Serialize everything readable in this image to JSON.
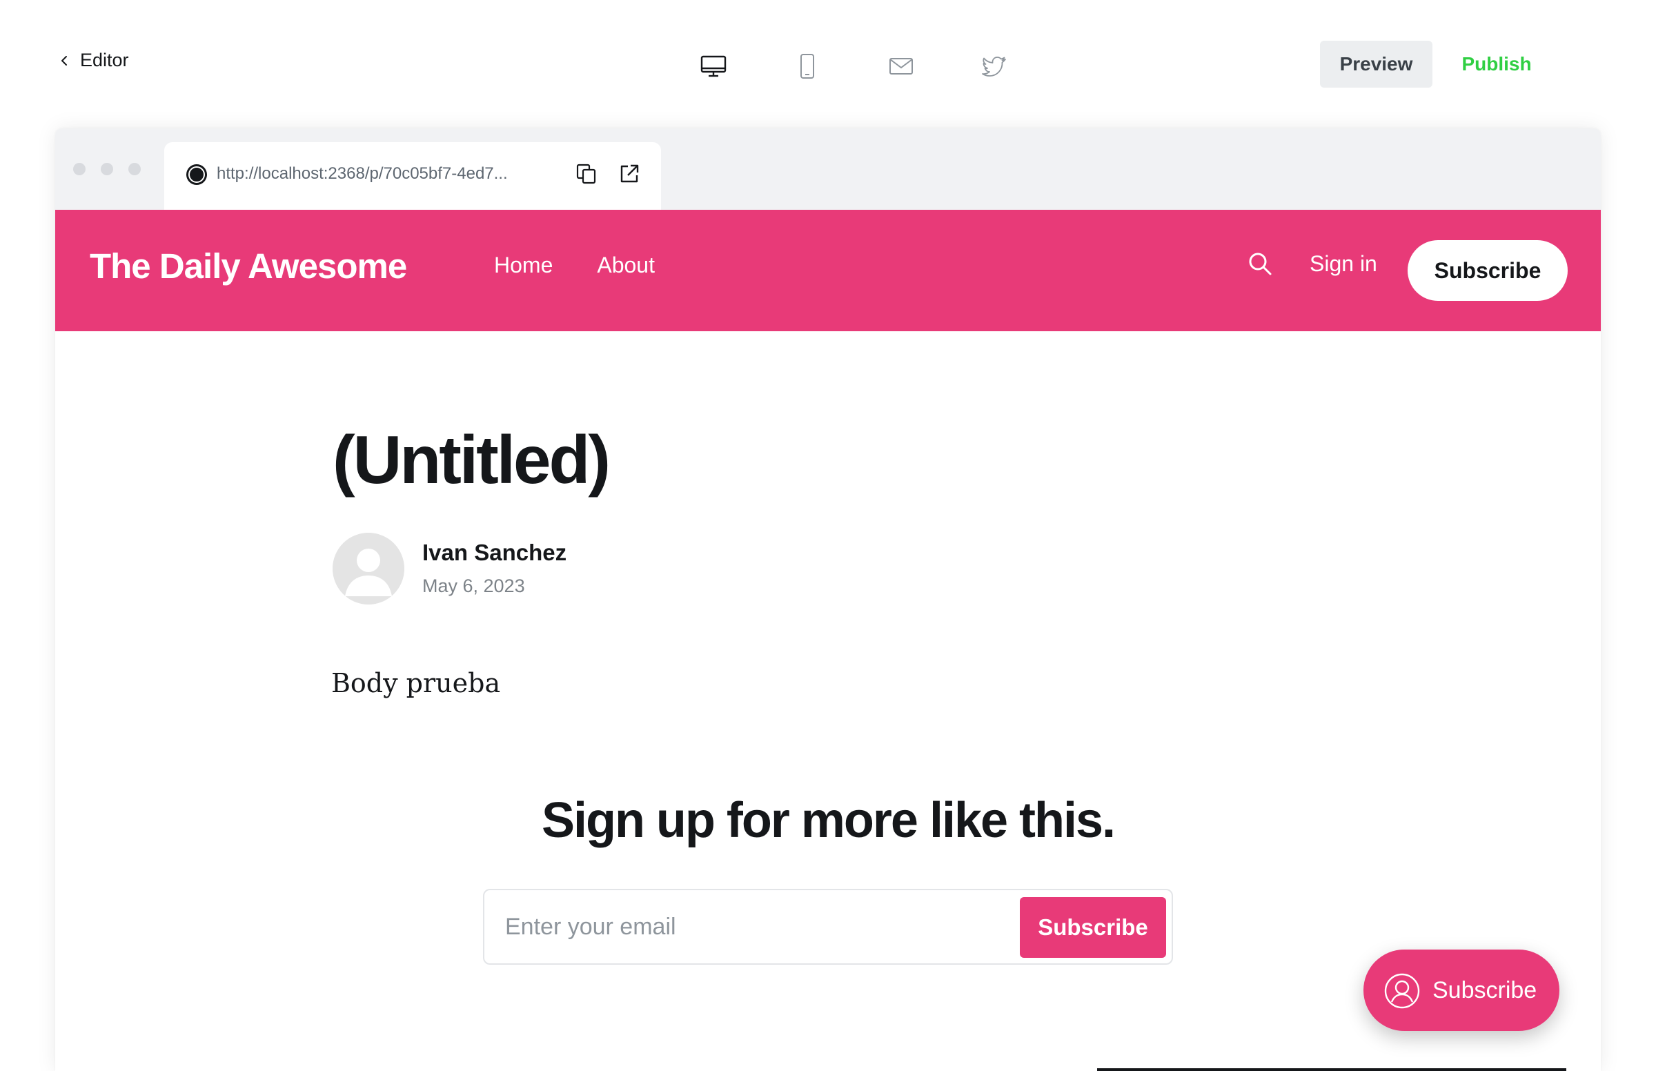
{
  "editor": {
    "back_label": "Editor",
    "preview_label": "Preview",
    "publish_label": "Publish",
    "devices": [
      "desktop",
      "mobile",
      "email",
      "twitter"
    ],
    "active_device": "desktop"
  },
  "browser": {
    "url": "http://localhost:2368/p/70c05bf7-4ed7..."
  },
  "site": {
    "title": "The Daily Awesome",
    "accent_color": "#e83a78",
    "nav": [
      "Home",
      "About"
    ],
    "signin_label": "Sign in",
    "subscribe_label": "Subscribe"
  },
  "post": {
    "title": "(Untitled)",
    "author": "Ivan Sanchez",
    "date": "May 6, 2023",
    "body": "Body prueba"
  },
  "cta": {
    "heading": "Sign up for more like this.",
    "email_placeholder": "Enter your email",
    "button_label": "Subscribe"
  },
  "portal": {
    "label": "Subscribe"
  }
}
